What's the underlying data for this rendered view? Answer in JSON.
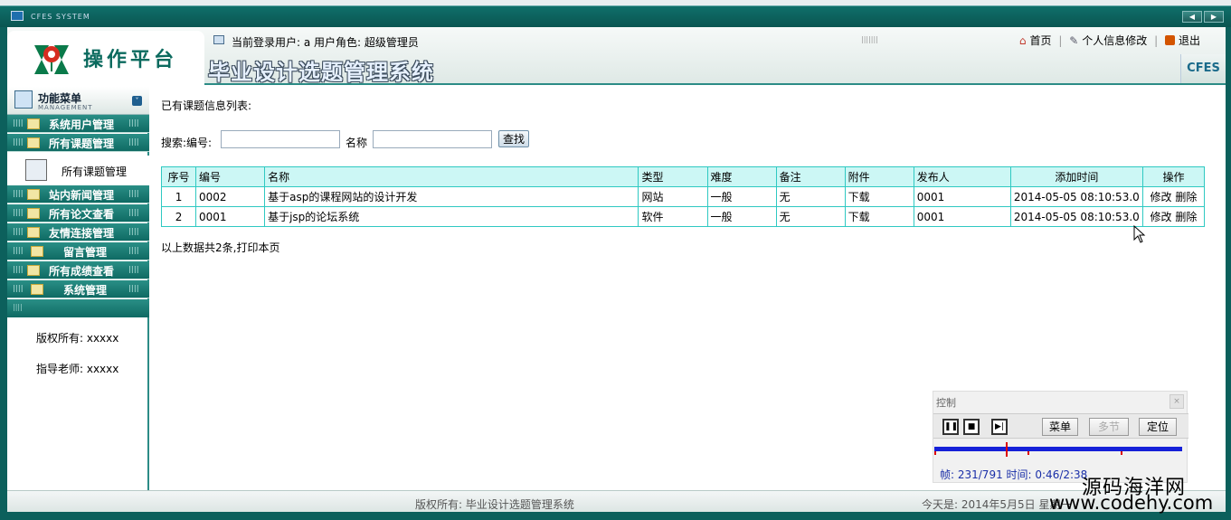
{
  "window": {
    "title": "CFES SYSTEM"
  },
  "header": {
    "logo_text": "操作平台",
    "user_text": "当前登录用户: a   用户角色: 超级管理员",
    "links": {
      "home": "首页",
      "profile": "个人信息修改",
      "exit": "退出"
    },
    "system_title": "毕业设计选题管理系统",
    "brand": "CFES"
  },
  "sidebar": {
    "head_title": "功能菜单",
    "head_sub": "MANAGEMENT",
    "items": [
      {
        "label": "系统用户管理"
      },
      {
        "label": "所有课题管理"
      },
      {
        "label": "站内新闻管理"
      },
      {
        "label": "所有论文查看"
      },
      {
        "label": "友情连接管理"
      },
      {
        "label": "留言管理"
      },
      {
        "label": "所有成绩查看"
      },
      {
        "label": "系统管理"
      }
    ],
    "active_sub": "所有课题管理",
    "copyright": "版权所有: xxxxx",
    "teacher": "指导老师: xxxxx"
  },
  "main": {
    "list_title": "已有课题信息列表:",
    "search": {
      "label_no": "搜索:编号:",
      "label_name": "名称",
      "no_value": "",
      "name_value": "",
      "button": "查找"
    },
    "columns": [
      "序号",
      "编号",
      "名称",
      "类型",
      "难度",
      "备注",
      "附件",
      "发布人",
      "添加时间",
      "操作"
    ],
    "rows": [
      {
        "seq": "1",
        "code": "0002",
        "name": "基于asp的课程网站的设计开发",
        "type": "网站",
        "difficulty": "一般",
        "note": "无",
        "attach": "下载",
        "publisher": "0001",
        "time": "2014-05-05 08:10:53.0",
        "edit": "修改",
        "delete": "删除"
      },
      {
        "seq": "2",
        "code": "0001",
        "name": "基于jsp的论坛系统",
        "type": "软件",
        "difficulty": "一般",
        "note": "无",
        "attach": "下载",
        "publisher": "0001",
        "time": "2014-05-05 08:10:53.0",
        "edit": "修改",
        "delete": "删除"
      }
    ],
    "summary": "以上数据共2条,打印本页"
  },
  "control": {
    "title": "控制",
    "buttons": {
      "menu": "菜单",
      "multi": "多节",
      "locate": "定位"
    },
    "info": "帧: 231/791 时间: 0:46/2:38",
    "progress": 0.29
  },
  "footer": {
    "copyright": "版权所有: 毕业设计选题管理系统",
    "today": "今天是: 2014年5月5日 星期一"
  },
  "watermark": {
    "line1": "源码海洋网",
    "line2": "www.codehy.com"
  }
}
